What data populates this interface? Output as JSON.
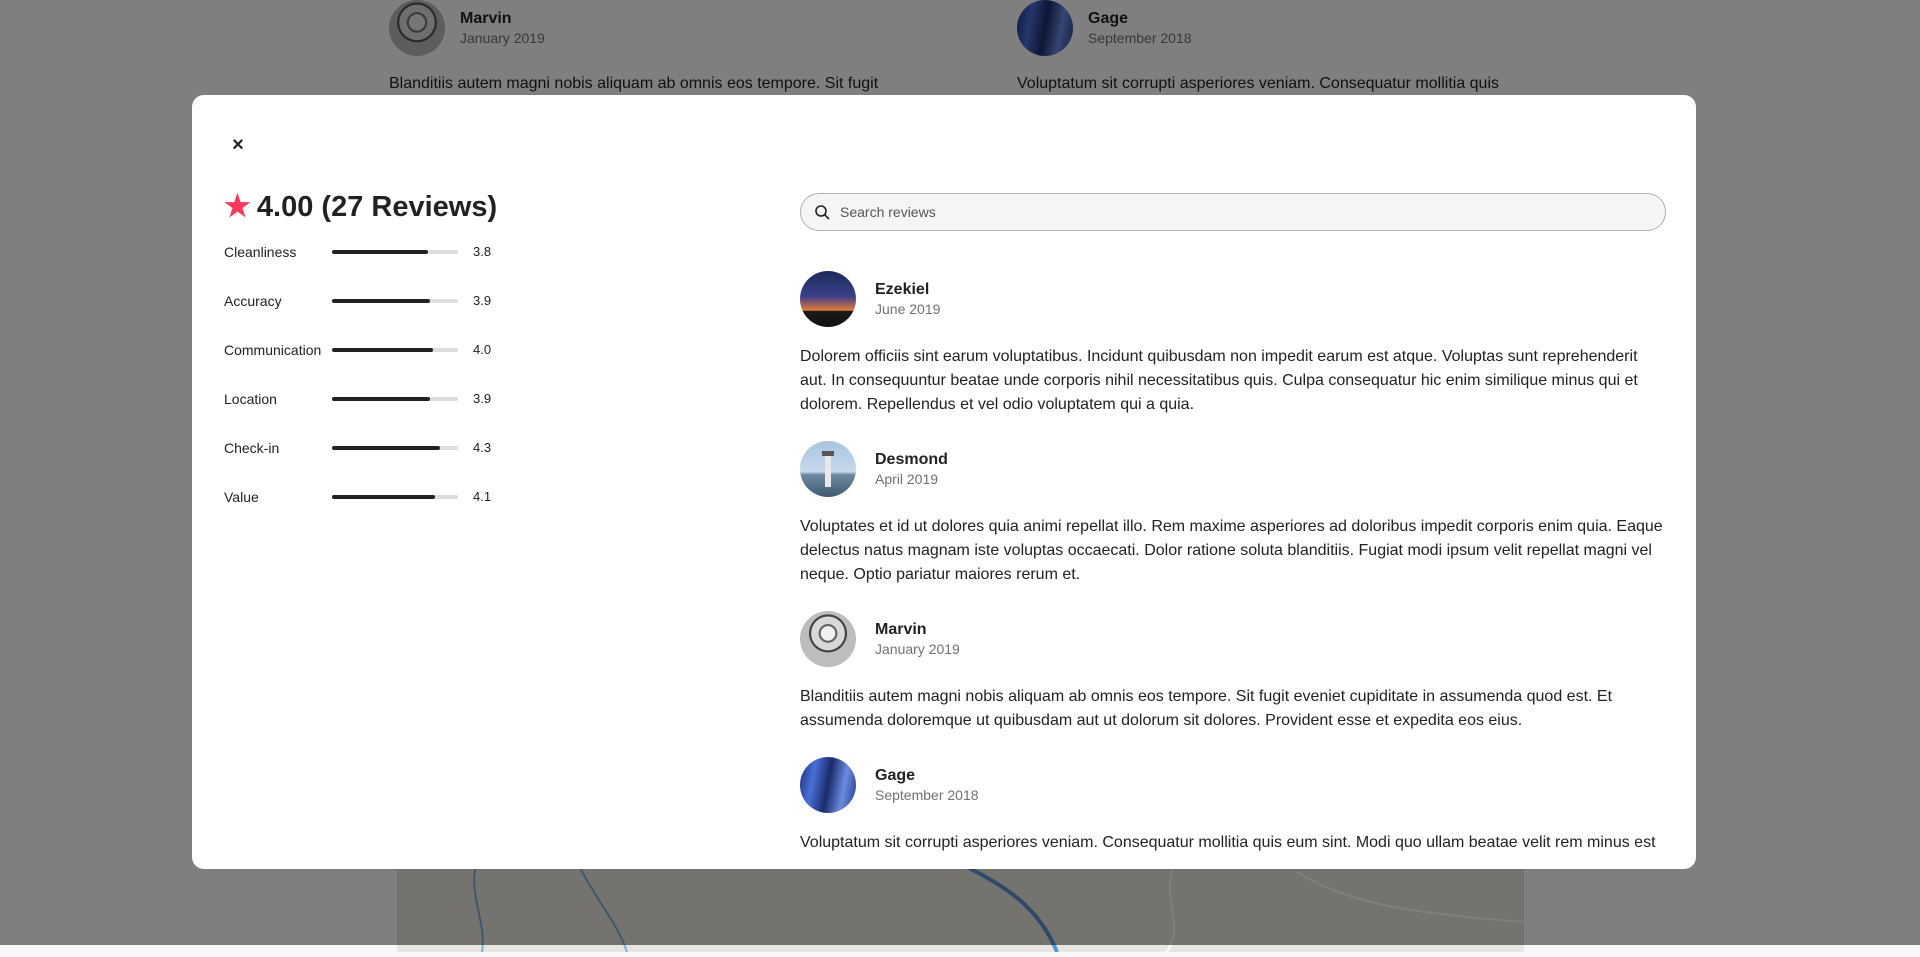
{
  "background": {
    "reviews": [
      {
        "name": "Marvin",
        "date": "January 2019",
        "text": "Blanditiis autem magni nobis aliquam ab omnis eos tempore. Sit fugit"
      },
      {
        "name": "Gage",
        "date": "September 2018",
        "text": "Voluptatum sit corrupti asperiores veniam. Consequatur mollitia quis"
      }
    ]
  },
  "modal": {
    "close_label": "×",
    "rating": {
      "summary": "4.00 (27 Reviews)",
      "categories": [
        {
          "label": "Cleanliness",
          "value": "3.8",
          "score": 3.8
        },
        {
          "label": "Accuracy",
          "value": "3.9",
          "score": 3.9
        },
        {
          "label": "Communication",
          "value": "4.0",
          "score": 4.0
        },
        {
          "label": "Location",
          "value": "3.9",
          "score": 3.9
        },
        {
          "label": "Check-in",
          "value": "4.3",
          "score": 4.3
        },
        {
          "label": "Value",
          "value": "4.1",
          "score": 4.1
        }
      ]
    },
    "search": {
      "placeholder": "Search reviews",
      "value": ""
    },
    "reviews": [
      {
        "name": "Ezekiel",
        "date": "June 2019",
        "text": "Dolorem officiis sint earum voluptatibus. Incidunt quibusdam non impedit earum est atque. Voluptas sunt reprehenderit aut. In consequuntur beatae unde corporis nihil necessitatibus quis. Culpa consequatur hic enim similique minus qui et dolorem. Repellendus et vel odio voluptatem qui a quia."
      },
      {
        "name": "Desmond",
        "date": "April 2019",
        "text": "Voluptates et id ut dolores quia animi repellat illo. Rem maxime asperiores ad doloribus impedit corporis enim quia. Eaque delectus natus magnam iste voluptas occaecati. Dolor ratione soluta blanditiis. Fugiat modi ipsum velit repellat magni vel neque. Optio pariatur maiores rerum et."
      },
      {
        "name": "Marvin",
        "date": "January 2019",
        "text": "Blanditiis autem magni nobis aliquam ab omnis eos tempore. Sit fugit eveniet cupiditate in assumenda quod est. Et assumenda doloremque ut quibusdam aut ut dolorum sit dolores. Provident esse et expedita eos eius."
      },
      {
        "name": "Gage",
        "date": "September 2018",
        "text": "Voluptatum sit corrupti asperiores veniam. Consequatur mollitia quis eum sint. Modi quo ullam beatae velit rem minus est"
      }
    ]
  },
  "colors": {
    "accent": "#ff385c",
    "bar": "#222222",
    "muted": "#717171"
  }
}
